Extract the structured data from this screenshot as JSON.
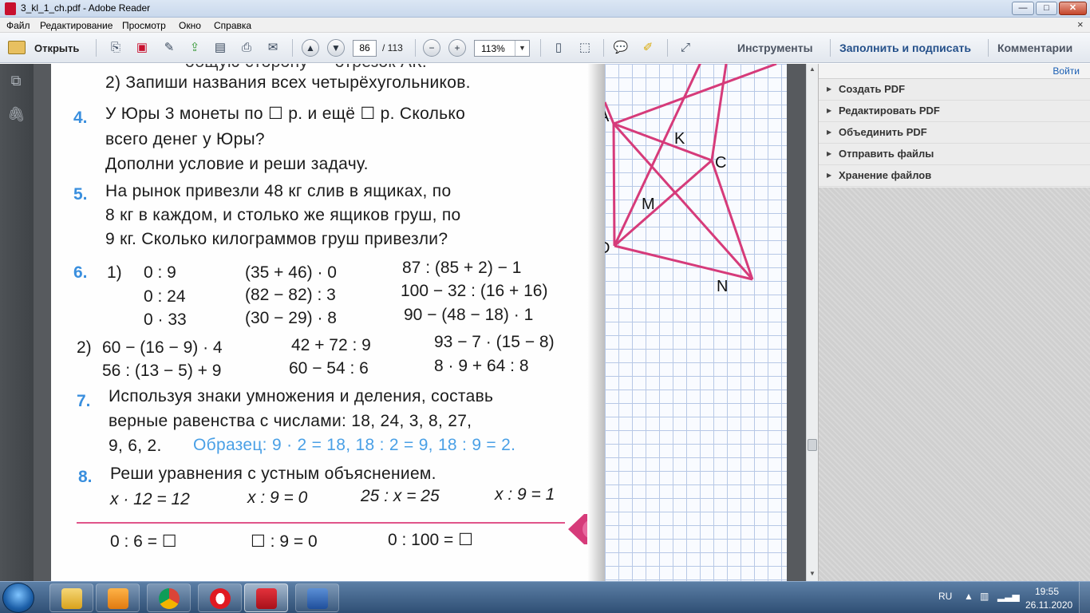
{
  "window": {
    "title": "3_kl_1_ch.pdf - Adobe Reader",
    "min": "—",
    "max": "□",
    "close": "✕"
  },
  "menu": {
    "items": [
      "Файл",
      "Редактирование",
      "Просмотр",
      "Окно",
      "Справка"
    ],
    "close_glyph": "×"
  },
  "toolbar": {
    "open_label": "Открыть",
    "page_current": "86",
    "page_total": "/ 113",
    "zoom": "113%",
    "tools": "Инструменты",
    "fill_sign": "Заполнить и подписать",
    "comments": "Комментарии"
  },
  "panel": {
    "login": "Войти",
    "items": [
      "Создать PDF",
      "Редактировать PDF",
      "Объединить PDF",
      "Отправить файлы",
      "Хранение файлов"
    ]
  },
  "doc": {
    "top_cut": "общую сторону — отрезок АК.",
    "t3_2": "2) Запиши названия всех четырёхугольников.",
    "t4_num": "4.",
    "t4_a": "У Юры 3 монеты по ☐ р. и ещё ☐ р. Сколько",
    "t4_b": "всего денег у Юры?",
    "t4_c": "Дополни условие и реши задачу.",
    "t5_num": "5.",
    "t5_a": "На рынок привезли 48 кг слив в ящиках, по",
    "t5_b": "8 кг в каждом, и столько же ящиков груш, по",
    "t5_c": "9 кг. Сколько килограммов груш привезли?",
    "t6_num": "6.",
    "t6_1": "1)",
    "t6_col1": [
      "0 : 9",
      "0 : 24",
      "0 · 33"
    ],
    "t6_col2": [
      "(35 + 46) · 0",
      "(82 − 82) : 3",
      "(30 − 29) · 8"
    ],
    "t6_col3": [
      "87 : (85 + 2) − 1",
      "100 − 32 : (16 + 16)",
      "90 − (48 − 18) · 1"
    ],
    "t6_2": "2)",
    "t6b_col1": [
      "60 − (16 − 9) · 4",
      "56 : (13 − 5) + 9"
    ],
    "t6b_col2": [
      "42 + 72 : 9",
      "60 − 54 : 6"
    ],
    "t6b_col3": [
      "93 − 7 · (15 − 8)",
      "8 · 9 + 64 : 8"
    ],
    "t7_num": "7.",
    "t7_a": "Используя знаки умножения и деления, составь",
    "t7_b": "верные равенства с числами: 18, 24, 3, 8, 27,",
    "t7_c": "9, 6, 2.",
    "t7_sample": "Образец:  9 · 2 = 18,  18 : 2 = 9,  18 : 9 = 2.",
    "t8_num": "8.",
    "t8_a": "Реши уравнения с устным объяснением.",
    "t8_eq": [
      "x · 12 = 12",
      "x : 9 = 0",
      "25 : x = 25",
      "x : 9 = 1"
    ],
    "bottom_eq": [
      "0 : 6 = ☐",
      "☐ : 9 = 0",
      "0 : 100 = ☐"
    ],
    "help": "?"
  },
  "figure": {
    "points": [
      "A",
      "K",
      "C",
      "M",
      "D",
      "N"
    ],
    "color": "#d63b7a"
  },
  "taskbar": {
    "lang": "RU",
    "time": "19:55",
    "date": "26.11.2020"
  }
}
